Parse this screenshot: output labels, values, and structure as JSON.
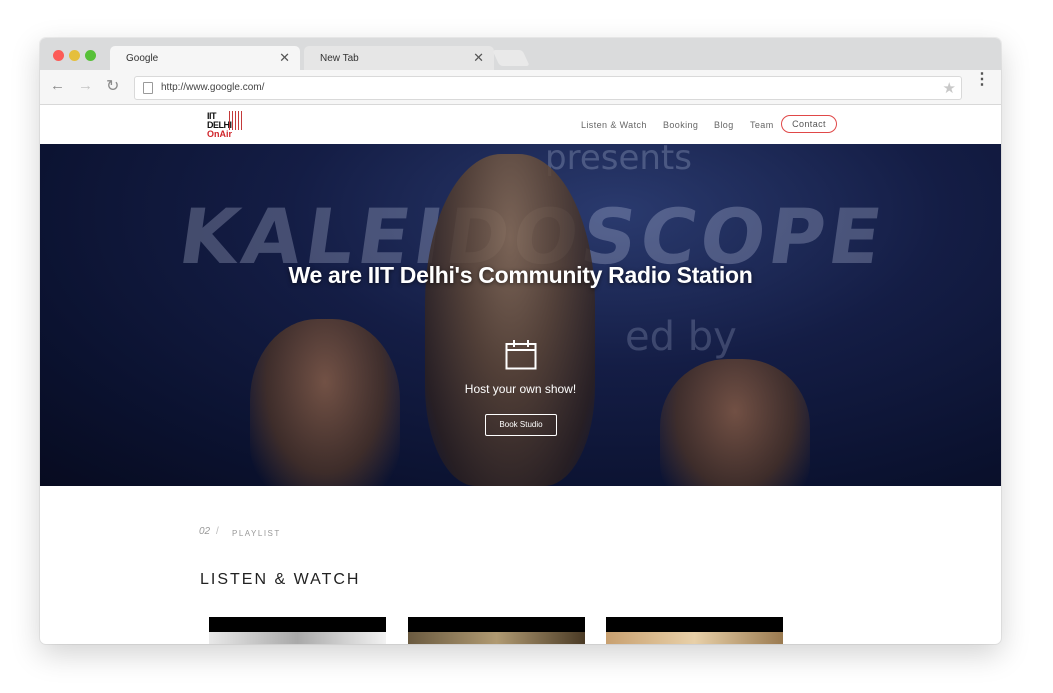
{
  "browser": {
    "tabs": [
      {
        "label": "Google",
        "close": "✕"
      },
      {
        "label": "New Tab",
        "close": "✕"
      }
    ],
    "url": "http://www.google.com/",
    "icons": {
      "back": "←",
      "forward": "→",
      "reload": "↻",
      "star": "★",
      "menu": "⋮"
    }
  },
  "site": {
    "logo": {
      "line1": "IIT",
      "line2": "DELHI",
      "line3": "OnAir"
    },
    "nav": [
      "Listen & Watch",
      "Booking",
      "Blog",
      "Team"
    ],
    "contact": "Contact"
  },
  "hero": {
    "title": "We are IIT Delhi's Community Radio Station",
    "subtitle": "Host your own show!",
    "button": "Book Studio",
    "background_text": {
      "main": "KALEIDOSCOPE",
      "top": "presents",
      "side": "ed by"
    }
  },
  "section": {
    "number": "02",
    "slash": "/",
    "label": "PLAYLIST",
    "title": "LISTEN & WATCH"
  },
  "colors": {
    "accent": "#e04848",
    "hero_bg": "#0b1230"
  }
}
